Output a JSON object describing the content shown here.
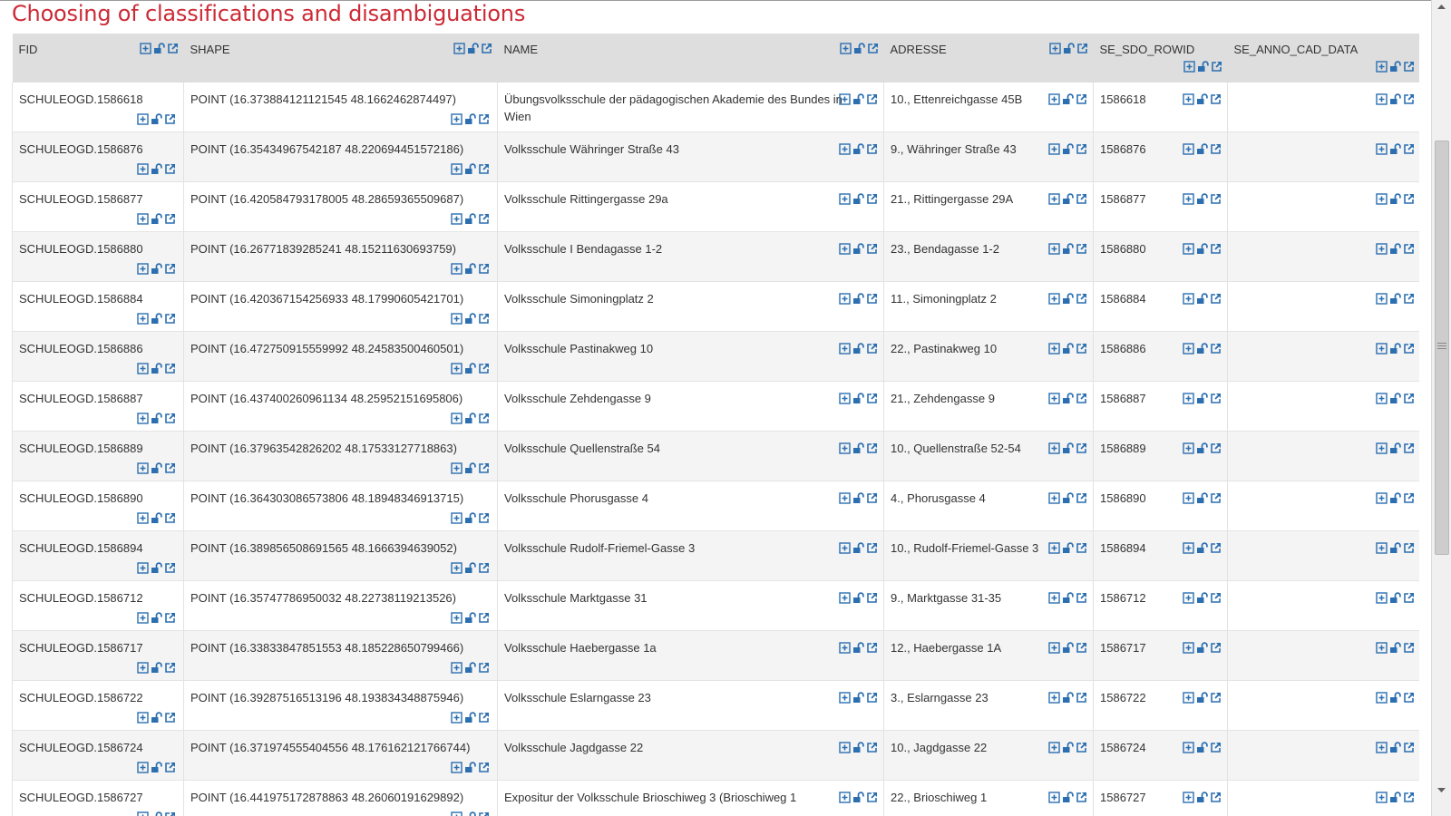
{
  "page": {
    "title": "Choosing of classifications and disambiguations"
  },
  "table": {
    "columns": [
      "FID",
      "SHAPE",
      "NAME",
      "ADRESSE",
      "SE_SDO_ROWID",
      "SE_ANNO_CAD_DATA"
    ],
    "cell_icons": [
      "expand-plus-icon",
      "unlock-icon",
      "open-external-icon"
    ],
    "rows": [
      {
        "fid": "SCHULEOGD.1586618",
        "shape": "POINT (16.373884121121545 48.1662462874497)",
        "name": "Übungsvolksschule der pädagogischen Akademie des Bundes in Wien",
        "adresse": "10., Ettenreichgasse 45B",
        "rowid": "1586618",
        "anno": ""
      },
      {
        "fid": "SCHULEOGD.1586876",
        "shape": "POINT (16.35434967542187 48.220694451572186)",
        "name": "Volksschule Währinger Straße 43",
        "adresse": "9., Währinger Straße 43",
        "rowid": "1586876",
        "anno": ""
      },
      {
        "fid": "SCHULEOGD.1586877",
        "shape": "POINT (16.420584793178005 48.28659365509687)",
        "name": "Volksschule Rittingergasse 29a",
        "adresse": "21., Rittingergasse 29A",
        "rowid": "1586877",
        "anno": ""
      },
      {
        "fid": "SCHULEOGD.1586880",
        "shape": "POINT (16.26771839285241 48.15211630693759)",
        "name": "Volksschule I Bendagasse 1-2",
        "adresse": "23., Bendagasse 1-2",
        "rowid": "1586880",
        "anno": ""
      },
      {
        "fid": "SCHULEOGD.1586884",
        "shape": "POINT (16.420367154256933 48.17990605421701)",
        "name": "Volksschule Simoningplatz 2",
        "adresse": "11., Simoningplatz 2",
        "rowid": "1586884",
        "anno": ""
      },
      {
        "fid": "SCHULEOGD.1586886",
        "shape": "POINT (16.472750915559992 48.24583500460501)",
        "name": "Volksschule Pastinakweg 10",
        "adresse": "22., Pastinakweg 10",
        "rowid": "1586886",
        "anno": ""
      },
      {
        "fid": "SCHULEOGD.1586887",
        "shape": "POINT (16.437400260961134 48.25952151695806)",
        "name": "Volksschule Zehdengasse 9",
        "adresse": "21., Zehdengasse 9",
        "rowid": "1586887",
        "anno": ""
      },
      {
        "fid": "SCHULEOGD.1586889",
        "shape": "POINT (16.37963542826202 48.17533127718863)",
        "name": "Volksschule Quellenstraße 54",
        "adresse": "10., Quellenstraße 52-54",
        "rowid": "1586889",
        "anno": ""
      },
      {
        "fid": "SCHULEOGD.1586890",
        "shape": "POINT (16.364303086573806 48.18948346913715)",
        "name": "Volksschule Phorusgasse 4",
        "adresse": "4., Phorusgasse 4",
        "rowid": "1586890",
        "anno": ""
      },
      {
        "fid": "SCHULEOGD.1586894",
        "shape": "POINT (16.389856508691565 48.1666394639052)",
        "name": "Volksschule Rudolf-Friemel-Gasse 3",
        "adresse": "10., Rudolf-Friemel-Gasse 3",
        "rowid": "1586894",
        "anno": ""
      },
      {
        "fid": "SCHULEOGD.1586712",
        "shape": "POINT (16.35747786950032 48.22738119213526)",
        "name": "Volksschule Marktgasse 31",
        "adresse": "9., Marktgasse 31-35",
        "rowid": "1586712",
        "anno": ""
      },
      {
        "fid": "SCHULEOGD.1586717",
        "shape": "POINT (16.33833847851553 48.185228650799466)",
        "name": "Volksschule Haebergasse 1a",
        "adresse": "12., Haebergasse 1A",
        "rowid": "1586717",
        "anno": ""
      },
      {
        "fid": "SCHULEOGD.1586722",
        "shape": "POINT (16.39287516513196 48.193834348875946)",
        "name": "Volksschule Eslarngasse 23",
        "adresse": "3., Eslarngasse 23",
        "rowid": "1586722",
        "anno": ""
      },
      {
        "fid": "SCHULEOGD.1586724",
        "shape": "POINT (16.371974555404556 48.176162121766744)",
        "name": "Volksschule Jagdgasse 22",
        "adresse": "10., Jagdgasse 22",
        "rowid": "1586724",
        "anno": ""
      },
      {
        "fid": "SCHULEOGD.1586727",
        "shape": "POINT (16.441975172878863 48.26060191629892)",
        "name": "Expositur der Volksschule Brioschiweg 3 (Brioschiweg 1",
        "adresse": "22., Brioschiweg 1",
        "rowid": "1586727",
        "anno": ""
      }
    ]
  },
  "colors": {
    "title": "#cc2a36",
    "icon": "#2c6fb0",
    "header_bg": "#dedede",
    "row_alt_bg": "#f4f4f4"
  }
}
